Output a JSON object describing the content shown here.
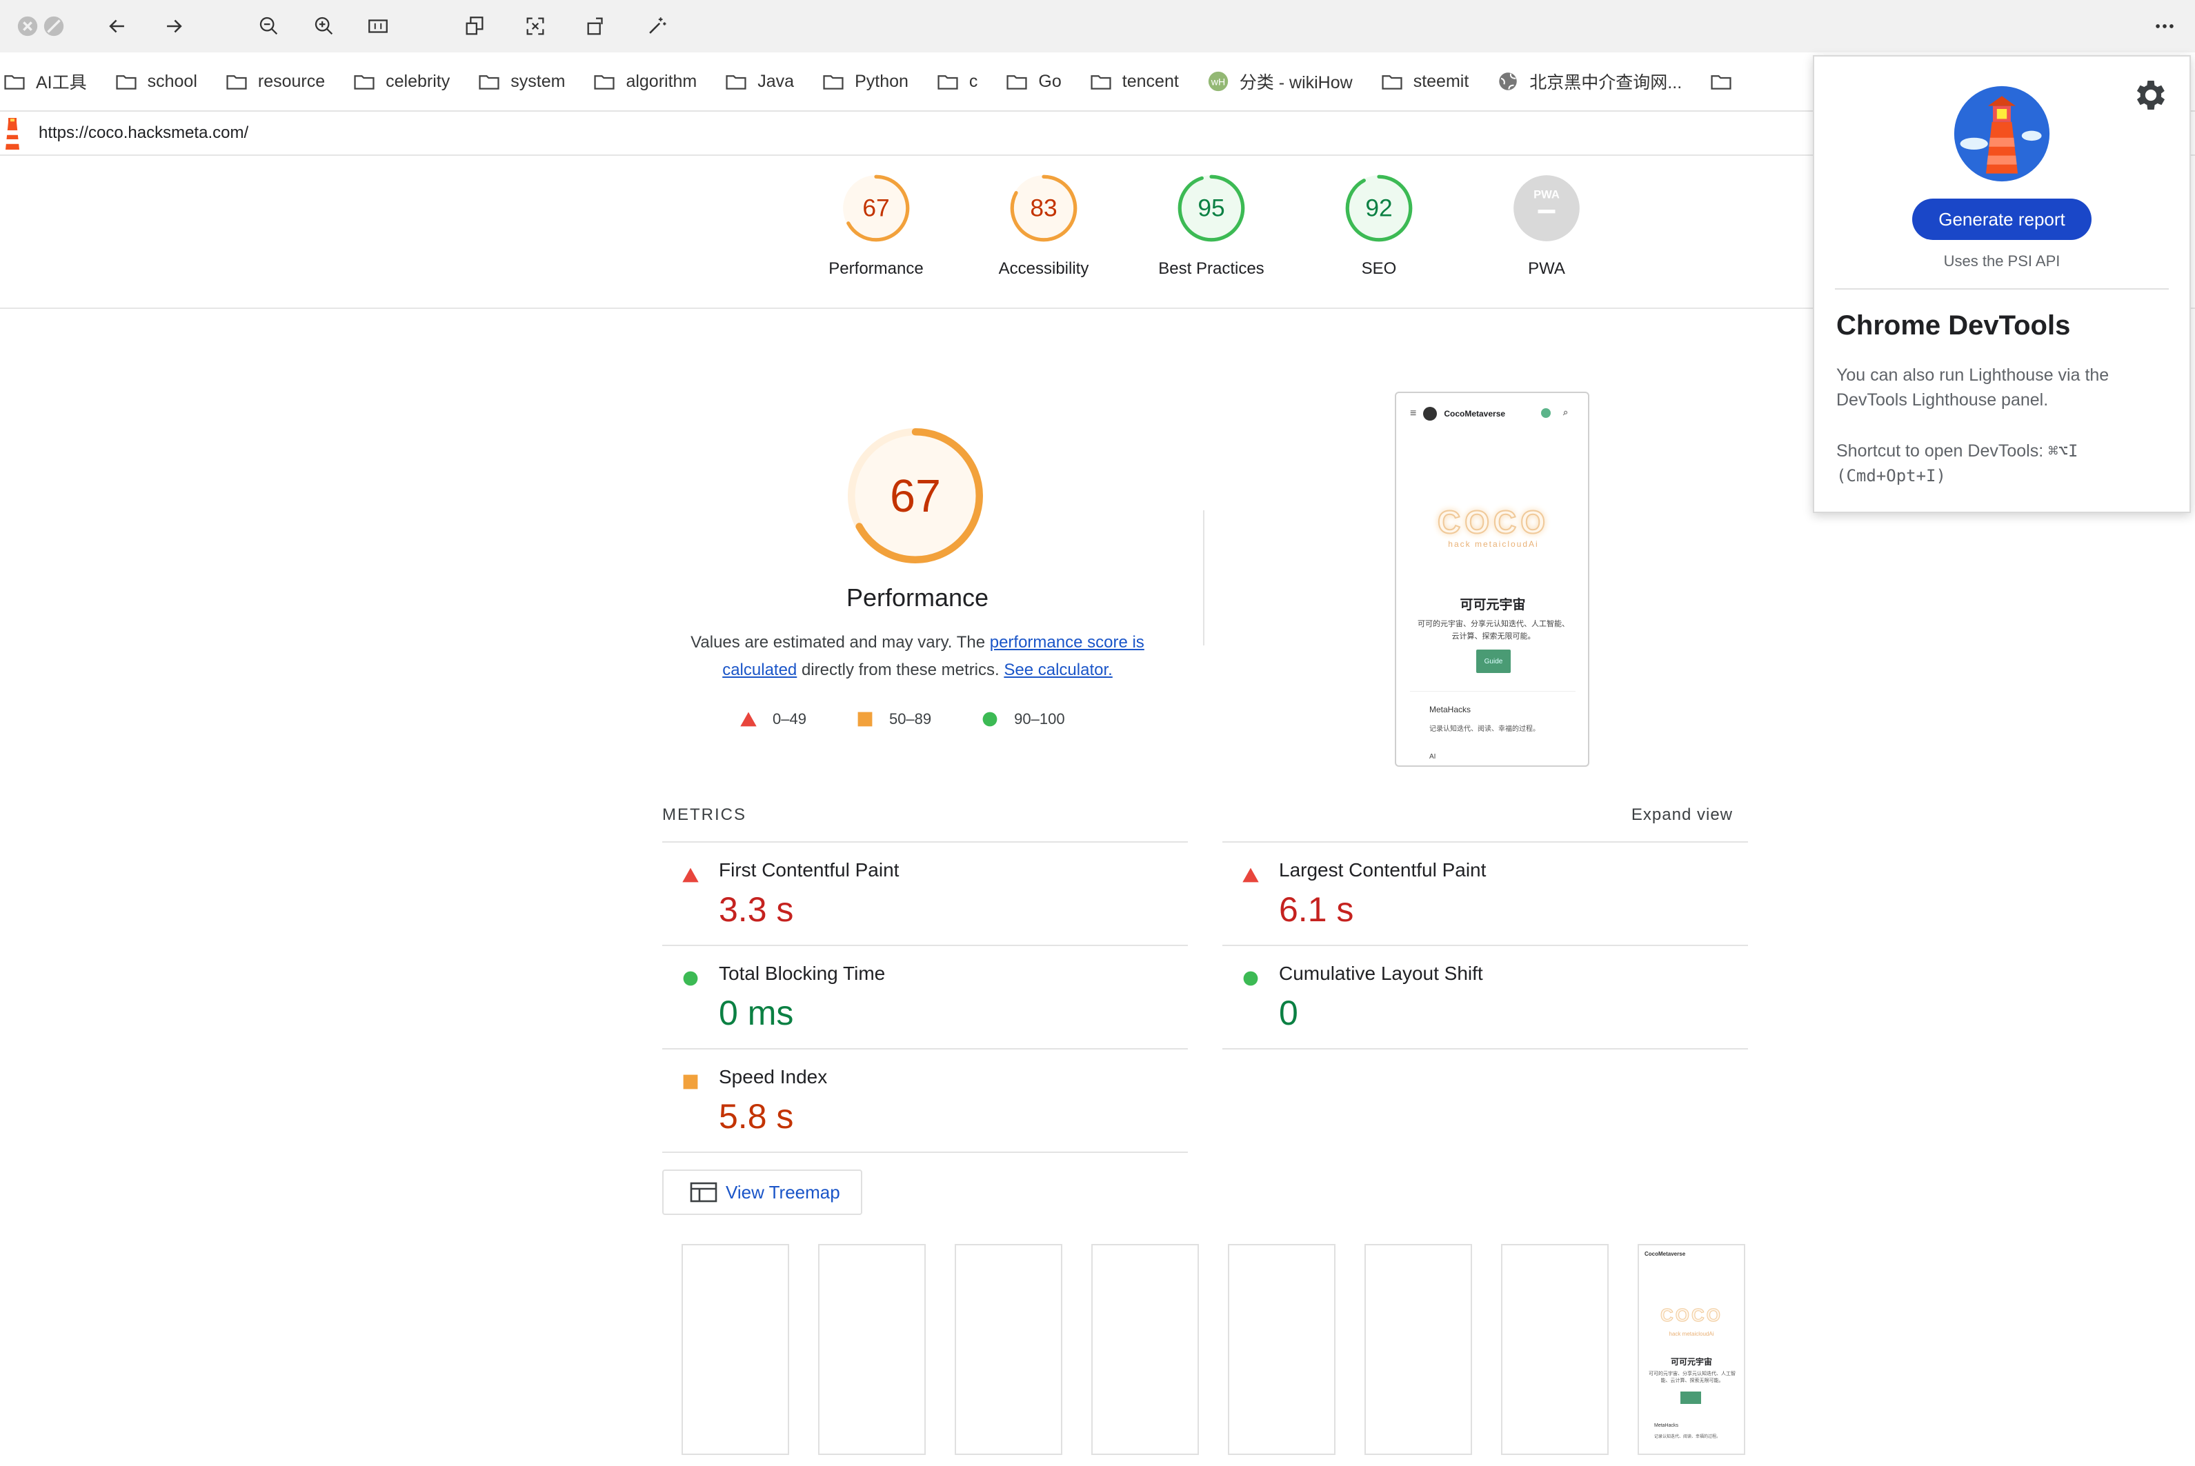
{
  "bookmarks": [
    {
      "label": "AI工具",
      "icon": "folder-icon"
    },
    {
      "label": "school",
      "icon": "folder-icon"
    },
    {
      "label": "resource",
      "icon": "folder-icon"
    },
    {
      "label": "celebrity",
      "icon": "folder-icon"
    },
    {
      "label": "system",
      "icon": "folder-icon"
    },
    {
      "label": "algorithm",
      "icon": "folder-icon"
    },
    {
      "label": "Java",
      "icon": "folder-icon"
    },
    {
      "label": "Python",
      "icon": "folder-icon"
    },
    {
      "label": "c",
      "icon": "folder-icon"
    },
    {
      "label": "Go",
      "icon": "folder-icon"
    },
    {
      "label": "tencent",
      "icon": "folder-icon"
    },
    {
      "label": "分类 - wikiHow",
      "icon": "wikihow-icon"
    },
    {
      "label": "steemit",
      "icon": "folder-icon"
    },
    {
      "label": "北京黑中介查询网...",
      "icon": "globe-icon"
    }
  ],
  "url": "https://coco.hacksmeta.com/",
  "scores": [
    {
      "label": "Performance",
      "value": "67",
      "fraction": 0.67,
      "color": "#f2a13b",
      "text_color": "#c33300",
      "bg": "#fff8ef"
    },
    {
      "label": "Accessibility",
      "value": "83",
      "fraction": 0.83,
      "color": "#f2a13b",
      "text_color": "#c33300",
      "bg": "#fff8ef"
    },
    {
      "label": "Best Practices",
      "value": "95",
      "fraction": 0.95,
      "color": "#3cba54",
      "text_color": "#0b8043",
      "bg": "#eefaf0"
    },
    {
      "label": "SEO",
      "value": "92",
      "fraction": 0.92,
      "color": "#3cba54",
      "text_color": "#0b8043",
      "bg": "#eefaf0"
    },
    {
      "label": "PWA",
      "value": "PWA",
      "fraction": 0,
      "color": "#d0d0d0",
      "text_color": "#ffffff",
      "bg": "#d9d9d9"
    }
  ],
  "performance": {
    "score": "67",
    "fraction": 0.67,
    "title": "Performance",
    "desc_before": "Values are estimated and may vary. The ",
    "desc_link": "performance score is calculated",
    "desc_middle": " directly from these metrics. ",
    "desc_link2": "See calculator."
  },
  "legend": [
    {
      "label": "0–49",
      "shape": "triangle",
      "color": "#e8453c"
    },
    {
      "label": "50–89",
      "shape": "square",
      "color": "#f2a13b"
    },
    {
      "label": "90–100",
      "shape": "circle",
      "color": "#3cba54"
    }
  ],
  "site_preview": {
    "site_name": "CocoMetaverse",
    "logo_text": "COCO",
    "logo_sub": "hack metaicloudAi",
    "cn_title": "可可元宇宙",
    "cn_desc": "可可的元宇宙、分享元认知迭代、人工智能、云计算、探索无限可能。",
    "button": "Guide",
    "section_title": "MetaHacks",
    "section_desc": "记录认知迭代、阅读、幸福的过程。",
    "extra": "AI"
  },
  "metrics": {
    "title": "METRICS",
    "expand": "Expand view",
    "items": [
      {
        "name": "First Contentful Paint",
        "value": "3.3 s",
        "rating": "triangle",
        "color": "#e8453c",
        "value_color": "#c5221f"
      },
      {
        "name": "Largest Contentful Paint",
        "value": "6.1 s",
        "rating": "triangle",
        "color": "#e8453c",
        "value_color": "#c5221f"
      },
      {
        "name": "Total Blocking Time",
        "value": "0 ms",
        "rating": "circle",
        "color": "#3cba54",
        "value_color": "#0b8043"
      },
      {
        "name": "Cumulative Layout Shift",
        "value": "0",
        "rating": "circle",
        "color": "#3cba54",
        "value_color": "#0b8043"
      },
      {
        "name": "Speed Index",
        "value": "5.8 s",
        "rating": "square",
        "color": "#f2a13b",
        "value_color": "#c33300"
      }
    ]
  },
  "treemap_label": "View Treemap",
  "popup": {
    "generate": "Generate report",
    "psi": "Uses the PSI API",
    "devtools_title": "Chrome DevTools",
    "devtools_desc": "You can also run Lighthouse via the DevTools Lighthouse panel.",
    "shortcut_label": "Shortcut to open DevTools: ",
    "shortcut_keys": "⌘⌥I (Cmd+Opt+I)"
  }
}
